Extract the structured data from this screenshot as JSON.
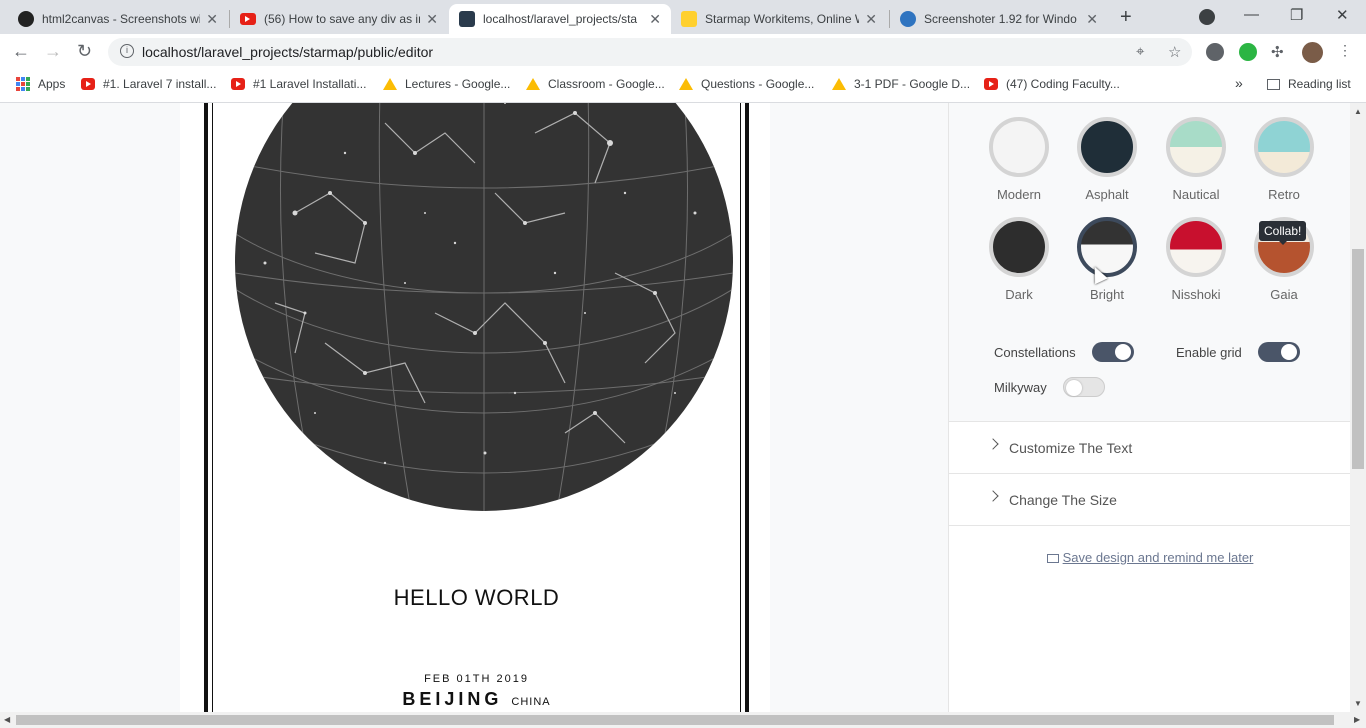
{
  "browser": {
    "tabs": [
      {
        "title": "html2canvas - Screenshots wi",
        "icon": "github-icon"
      },
      {
        "title": "(56) How to save any div as in",
        "icon": "youtube-icon"
      },
      {
        "title": "localhost/laravel_projects/sta",
        "icon": "page-icon"
      },
      {
        "title": "Starmap Workitems, Online W",
        "icon": "miro-icon"
      },
      {
        "title": "Screenshoter 1.92 for Windo",
        "icon": "screenshoter-icon"
      }
    ],
    "url": "localhost/laravel_projects/starmap/public/editor",
    "bookmarks": [
      {
        "label": "Apps",
        "icon": "apps-grid-icon"
      },
      {
        "label": "#1. Laravel 7 install...",
        "icon": "youtube-icon"
      },
      {
        "label": "#1 Laravel Installati...",
        "icon": "youtube-icon"
      },
      {
        "label": "Lectures - Google...",
        "icon": "google-drive-icon"
      },
      {
        "label": "Classroom - Google...",
        "icon": "google-drive-icon"
      },
      {
        "label": "Questions - Google...",
        "icon": "google-drive-icon"
      },
      {
        "label": "3-1 PDF - Google D...",
        "icon": "google-drive-icon"
      },
      {
        "label": "(47) Coding Faculty...",
        "icon": "youtube-icon"
      }
    ],
    "more_bookmarks": "»",
    "reading_list": "Reading list"
  },
  "poster": {
    "title": "HELLO WORLD",
    "date": "FEB 01TH 2019",
    "city": "BEIJING",
    "country": "CHINA"
  },
  "themes": [
    {
      "label": "Modern",
      "bg": "#f4f4f4",
      "top": "#fafafa"
    },
    {
      "label": "Asphalt",
      "bg": "#1f2e38",
      "top": "#1f2e38"
    },
    {
      "label": "Nautical",
      "bg": "#f5f1e6",
      "top": "#a8dcc8"
    },
    {
      "label": "Retro",
      "bg": "#f3ead8",
      "top": "#8fd3d4"
    },
    {
      "label": "Dark",
      "bg": "#2d2d2d",
      "top": "#2d2d2d"
    },
    {
      "label": "Bright",
      "bg": "#f7f7f7",
      "top": "#333333"
    },
    {
      "label": "Nisshoki",
      "bg": "#f7f4ef",
      "top": "#c8102e"
    },
    {
      "label": "Gaia",
      "bg": "#f1eadf",
      "top": "#b5532f"
    }
  ],
  "tooltip": "Collab!",
  "toggles": {
    "constellations": {
      "label": "Constellations",
      "on": true
    },
    "grid": {
      "label": "Enable grid",
      "on": true
    },
    "milkyway": {
      "label": "Milkyway",
      "on": false
    }
  },
  "sections": {
    "customize_text": "Customize The Text",
    "change_size": "Change The Size"
  },
  "save_link": "Save design and remind me later",
  "colors": {
    "accent": "#4a5568",
    "link": "#6b7790"
  }
}
